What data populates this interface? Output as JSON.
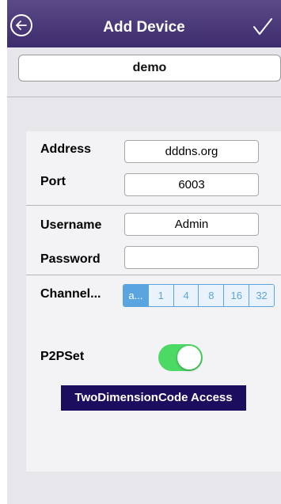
{
  "header": {
    "title": "Add Device",
    "back_icon": "arrow-left-circle-icon",
    "confirm_icon": "checkmark-icon",
    "bar_color": "#4a3a7a"
  },
  "device_name": {
    "value": "demo"
  },
  "form": {
    "address": {
      "label": "Address",
      "value": "dddns.org"
    },
    "port": {
      "label": "Port",
      "value": "6003"
    },
    "username": {
      "label": "Username",
      "value": "Admin"
    },
    "password": {
      "label": "Password",
      "value": ""
    },
    "channel": {
      "label": "Channel...",
      "options": [
        "a...",
        "1",
        "4",
        "8",
        "16",
        "32"
      ],
      "selected": "a...",
      "accent_color": "#5aa5e0"
    },
    "p2p": {
      "label": "P2PSet",
      "on": true,
      "on_color": "#4cd964"
    }
  },
  "qr_button": {
    "label": "TwoDimensionCode Access",
    "color": "#1d0d5e"
  }
}
